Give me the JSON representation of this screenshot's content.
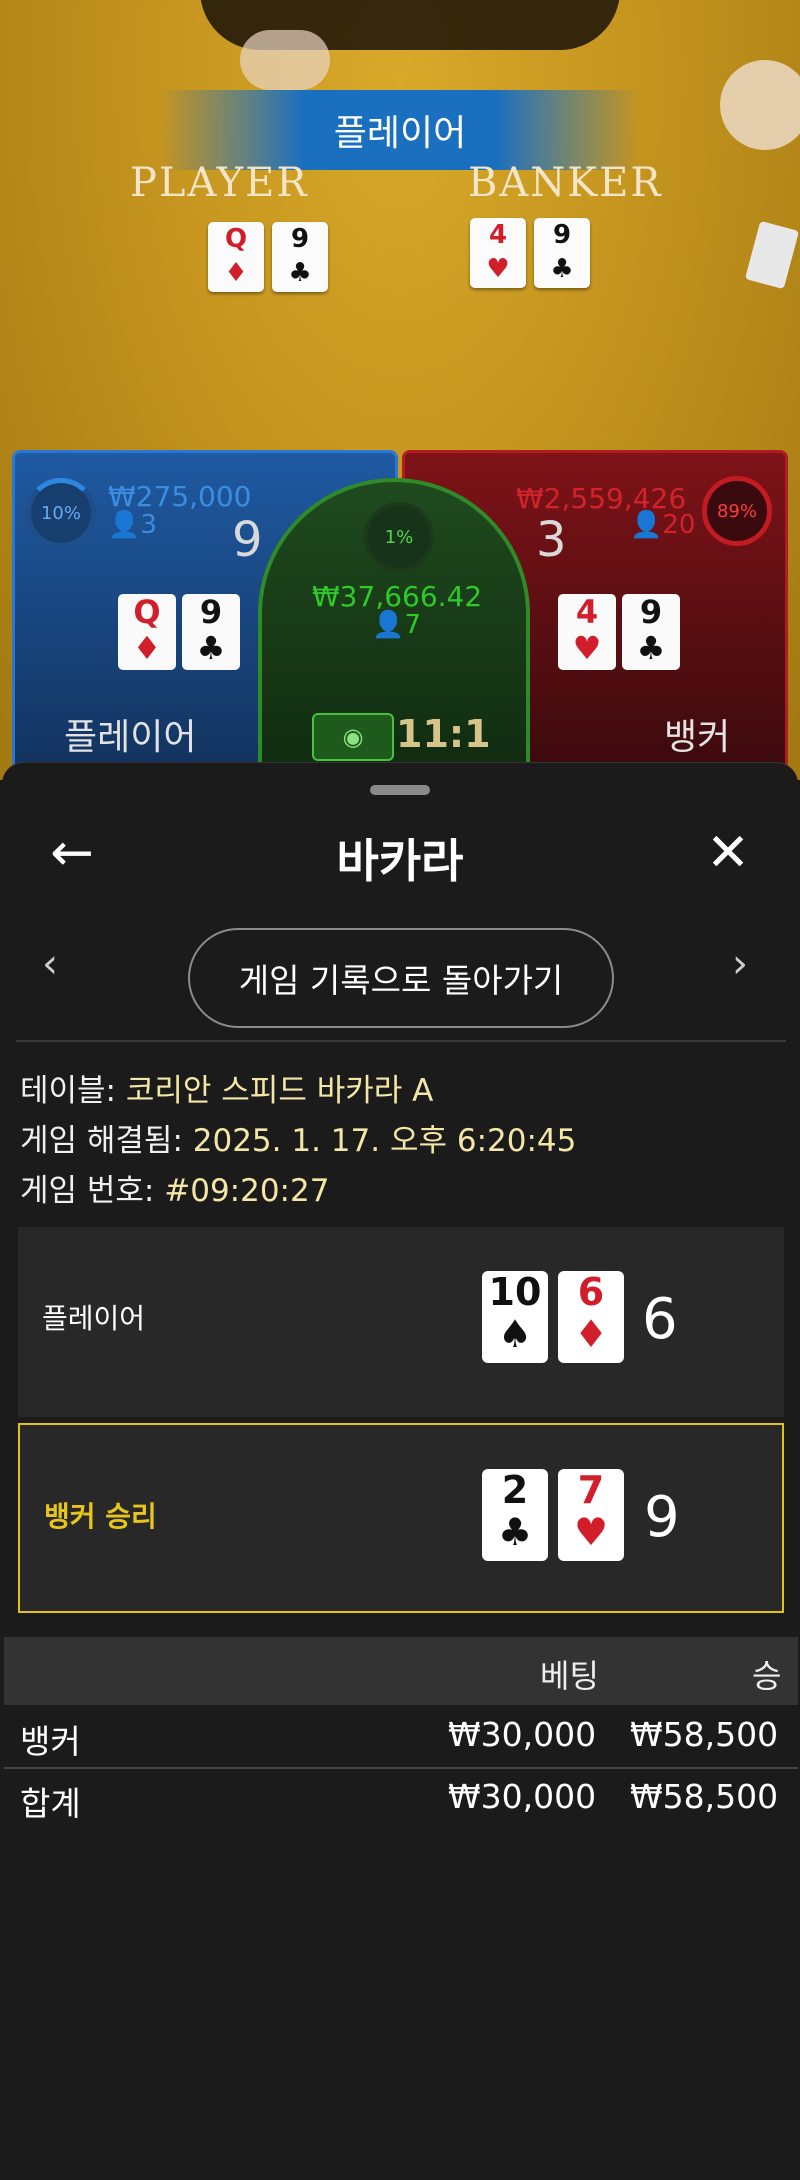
{
  "live": {
    "result_banner": "플레이어",
    "felt_player_label": "PLAYER",
    "felt_banker_label": "BANKER",
    "felt_player_cards": [
      {
        "rank": "Q",
        "suit": "♦",
        "color": "red"
      },
      {
        "rank": "9",
        "suit": "♣",
        "color": "black"
      }
    ],
    "felt_banker_cards": [
      {
        "rank": "4",
        "suit": "♥",
        "color": "red"
      },
      {
        "rank": "9",
        "suit": "♣",
        "color": "black"
      }
    ],
    "player": {
      "percent": "10%",
      "amount": "₩275,000",
      "count": "3",
      "score": "9",
      "label": "플레이어",
      "cards": [
        {
          "rank": "Q",
          "suit": "♦",
          "color": "red"
        },
        {
          "rank": "9",
          "suit": "♣",
          "color": "black"
        }
      ]
    },
    "banker": {
      "percent": "89%",
      "amount": "₩2,559,426",
      "count": "20",
      "score": "3",
      "label": "뱅커",
      "cards": [
        {
          "rank": "4",
          "suit": "♥",
          "color": "red"
        },
        {
          "rank": "9",
          "suit": "♣",
          "color": "black"
        }
      ]
    },
    "tie": {
      "percent": "1%",
      "amount": "₩37,666.42",
      "count": "7",
      "payout": "11:1"
    },
    "colors": {
      "player": "#2b78d4",
      "banker": "#b11b22",
      "tie": "#2f8a2a",
      "win_highlight": "#e3c217"
    }
  },
  "sheet": {
    "title": "바카라",
    "back_icon": "arrow-left-icon",
    "close_icon": "close-icon",
    "prev_icon": "chevron-left-icon",
    "next_icon": "chevron-right-icon",
    "return_label": "게임 기록으로 돌아가기",
    "info": [
      {
        "label": "테이블:",
        "value": "코리안 스피드 바카라 A"
      },
      {
        "label": "게임 해결됨:",
        "value": "2025. 1. 17. 오후 6:20:45"
      },
      {
        "label": "게임 번호:",
        "value": "#09:20:27"
      }
    ],
    "hands": {
      "player": {
        "title": "플레이어",
        "score": "6",
        "cards": [
          {
            "rank": "10",
            "suit": "♠",
            "color": "black"
          },
          {
            "rank": "6",
            "suit": "♦",
            "color": "red"
          }
        ]
      },
      "banker": {
        "title": "뱅커 승리",
        "score": "9",
        "cards": [
          {
            "rank": "2",
            "suit": "♣",
            "color": "black"
          },
          {
            "rank": "7",
            "suit": "♥",
            "color": "red"
          }
        ]
      }
    },
    "table": {
      "headers": {
        "bet": "베팅",
        "win": "승"
      },
      "rows": [
        {
          "name": "뱅커",
          "bet": "₩30,000",
          "win": "₩58,500"
        },
        {
          "name": "합계",
          "bet": "₩30,000",
          "win": "₩58,500"
        }
      ]
    }
  }
}
